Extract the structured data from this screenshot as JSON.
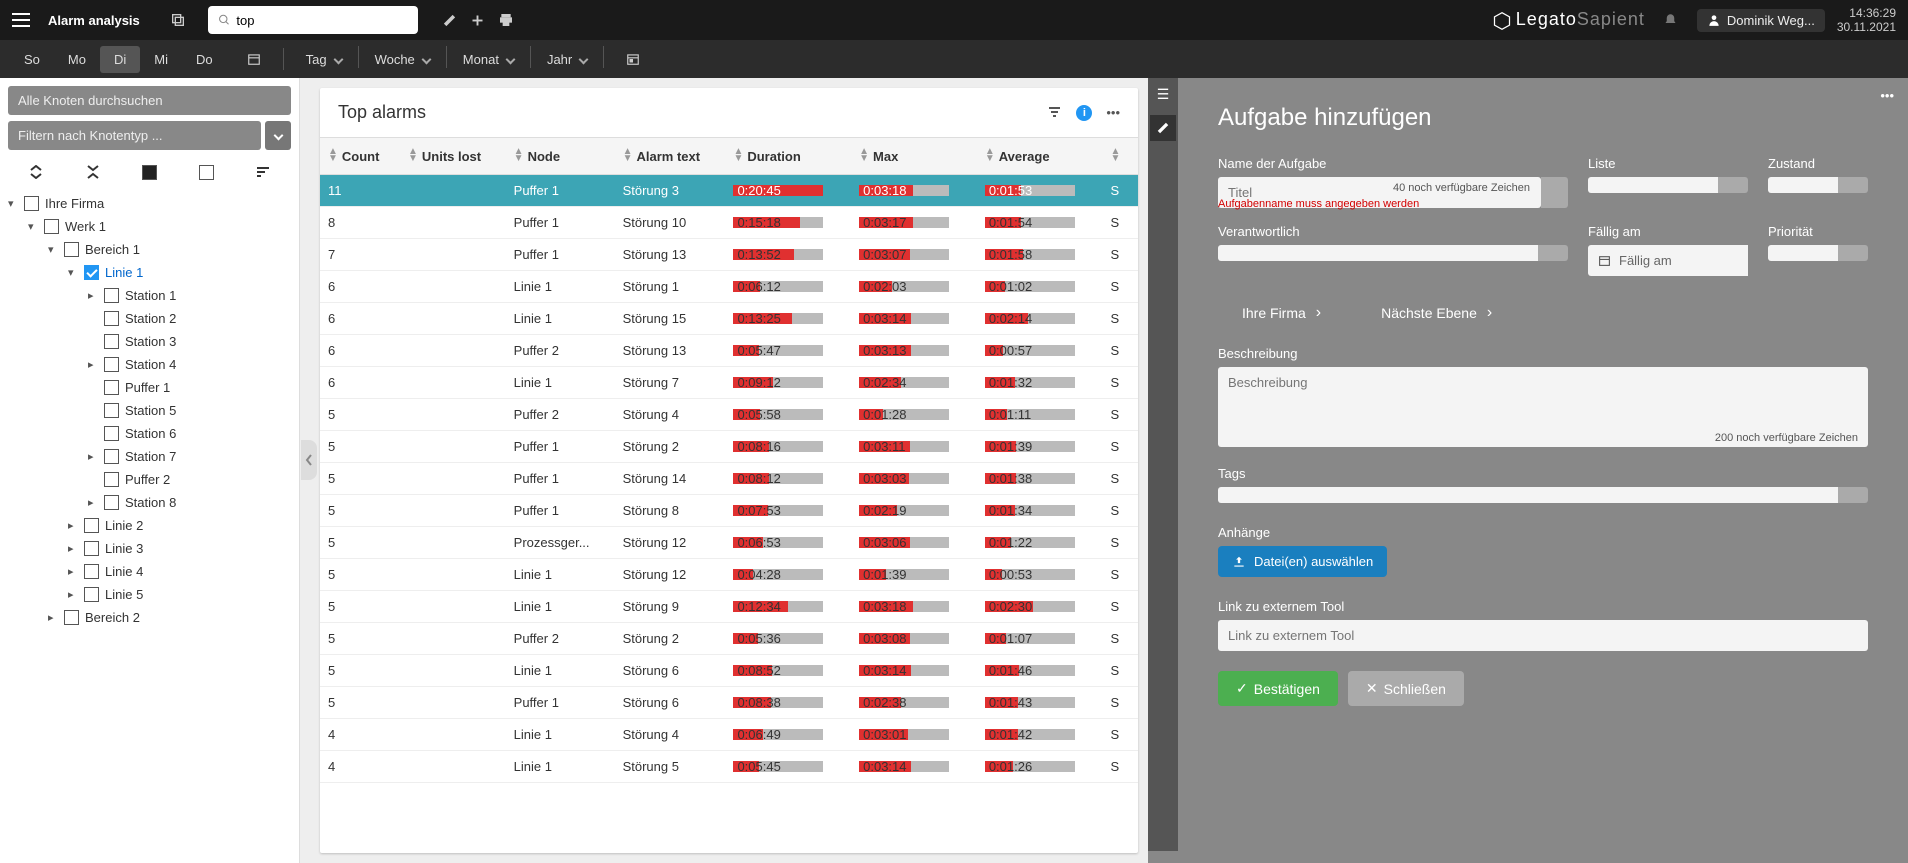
{
  "header": {
    "title": "Alarm analysis",
    "search_value": "top",
    "logo_main": "Legato",
    "logo_sub": "Sapient",
    "user": "Dominik Weg...",
    "time": "14:36:29",
    "date": "30.11.2021"
  },
  "toolbar": {
    "days": [
      "So",
      "Mo",
      "Di",
      "Mi",
      "Do"
    ],
    "day_active": "Di",
    "periods": [
      "Tag",
      "Woche",
      "Monat",
      "Jahr"
    ]
  },
  "sidebar": {
    "search_placeholder": "Alle Knoten durchsuchen",
    "filter_placeholder": "Filtern nach Knotentyp ...",
    "tree": [
      {
        "label": "Ihre Firma",
        "open": true,
        "children": [
          {
            "label": "Werk 1",
            "open": true,
            "children": [
              {
                "label": "Bereich 1",
                "open": true,
                "children": [
                  {
                    "label": "Linie 1",
                    "link": true,
                    "checked": true,
                    "open": true,
                    "children": [
                      {
                        "label": "Station 1",
                        "caret": true
                      },
                      {
                        "label": "Station 2"
                      },
                      {
                        "label": "Station 3"
                      },
                      {
                        "label": "Station 4",
                        "caret": true
                      },
                      {
                        "label": "Puffer 1"
                      },
                      {
                        "label": "Station 5"
                      },
                      {
                        "label": "Station 6"
                      },
                      {
                        "label": "Station 7",
                        "caret": true
                      },
                      {
                        "label": "Puffer 2"
                      },
                      {
                        "label": "Station 8",
                        "caret": true
                      }
                    ]
                  },
                  {
                    "label": "Linie 2",
                    "caret": true
                  },
                  {
                    "label": "Linie 3",
                    "caret": true
                  },
                  {
                    "label": "Linie 4",
                    "caret": true
                  },
                  {
                    "label": "Linie 5",
                    "caret": true
                  }
                ]
              },
              {
                "label": "Bereich 2",
                "caret": true
              }
            ]
          }
        ]
      }
    ]
  },
  "panel": {
    "title": "Top alarms",
    "columns": [
      "Count",
      "Units lost",
      "Node",
      "Alarm text",
      "Duration",
      "Max",
      "Average",
      ""
    ],
    "rows": [
      {
        "count": "11",
        "units": "",
        "node": "Puffer 1",
        "alarm": "Störung 3",
        "dur": "0:20:45",
        "dur_p": 100,
        "max": "0:03:18",
        "max_p": 60,
        "avg": "0:01:53",
        "avg_p": 40,
        "last": "S",
        "sel": true
      },
      {
        "count": "8",
        "units": "",
        "node": "Puffer 1",
        "alarm": "Störung 10",
        "dur": "0:15:18",
        "dur_p": 74,
        "max": "0:03:17",
        "max_p": 60,
        "avg": "0:01:54",
        "avg_p": 40
      },
      {
        "count": "7",
        "units": "",
        "node": "Puffer 1",
        "alarm": "Störung 13",
        "dur": "0:13:52",
        "dur_p": 67,
        "max": "0:03:07",
        "max_p": 56,
        "avg": "0:01:58",
        "avg_p": 42
      },
      {
        "count": "6",
        "units": "",
        "node": "Linie 1",
        "alarm": "Störung 1",
        "dur": "0:06:12",
        "dur_p": 30,
        "max": "0:02:03",
        "max_p": 37,
        "avg": "0:01:02",
        "avg_p": 22
      },
      {
        "count": "6",
        "units": "",
        "node": "Linie 1",
        "alarm": "Störung 15",
        "dur": "0:13:25",
        "dur_p": 65,
        "max": "0:03:14",
        "max_p": 58,
        "avg": "0:02:14",
        "avg_p": 48
      },
      {
        "count": "6",
        "units": "",
        "node": "Puffer 2",
        "alarm": "Störung 13",
        "dur": "0:05:47",
        "dur_p": 28,
        "max": "0:03:13",
        "max_p": 58,
        "avg": "0:00:57",
        "avg_p": 20
      },
      {
        "count": "6",
        "units": "",
        "node": "Linie 1",
        "alarm": "Störung 7",
        "dur": "0:09:12",
        "dur_p": 44,
        "max": "0:02:34",
        "max_p": 46,
        "avg": "0:01:32",
        "avg_p": 33
      },
      {
        "count": "5",
        "units": "",
        "node": "Puffer 2",
        "alarm": "Störung 4",
        "dur": "0:05:58",
        "dur_p": 29,
        "max": "0:01:28",
        "max_p": 27,
        "avg": "0:01:11",
        "avg_p": 25
      },
      {
        "count": "5",
        "units": "",
        "node": "Puffer 1",
        "alarm": "Störung 2",
        "dur": "0:08:16",
        "dur_p": 40,
        "max": "0:03:11",
        "max_p": 57,
        "avg": "0:01:39",
        "avg_p": 35
      },
      {
        "count": "5",
        "units": "",
        "node": "Puffer 1",
        "alarm": "Störung 14",
        "dur": "0:08:12",
        "dur_p": 40,
        "max": "0:03:03",
        "max_p": 55,
        "avg": "0:01:38",
        "avg_p": 35
      },
      {
        "count": "5",
        "units": "",
        "node": "Puffer 1",
        "alarm": "Störung 8",
        "dur": "0:07:53",
        "dur_p": 38,
        "max": "0:02:19",
        "max_p": 42,
        "avg": "0:01:34",
        "avg_p": 34
      },
      {
        "count": "5",
        "units": "",
        "node": "Prozessger...",
        "alarm": "Störung 12",
        "dur": "0:06:53",
        "dur_p": 33,
        "max": "0:03:06",
        "max_p": 56,
        "avg": "0:01:22",
        "avg_p": 29
      },
      {
        "count": "5",
        "units": "",
        "node": "Linie 1",
        "alarm": "Störung 12",
        "dur": "0:04:28",
        "dur_p": 22,
        "max": "0:01:39",
        "max_p": 30,
        "avg": "0:00:53",
        "avg_p": 19
      },
      {
        "count": "5",
        "units": "",
        "node": "Linie 1",
        "alarm": "Störung 9",
        "dur": "0:12:34",
        "dur_p": 61,
        "max": "0:03:18",
        "max_p": 60,
        "avg": "0:02:30",
        "avg_p": 54
      },
      {
        "count": "5",
        "units": "",
        "node": "Puffer 2",
        "alarm": "Störung 2",
        "dur": "0:05:36",
        "dur_p": 27,
        "max": "0:03:08",
        "max_p": 56,
        "avg": "0:01:07",
        "avg_p": 24
      },
      {
        "count": "5",
        "units": "",
        "node": "Linie 1",
        "alarm": "Störung 6",
        "dur": "0:08:52",
        "dur_p": 43,
        "max": "0:03:14",
        "max_p": 58,
        "avg": "0:01:46",
        "avg_p": 38
      },
      {
        "count": "5",
        "units": "",
        "node": "Puffer 1",
        "alarm": "Störung 6",
        "dur": "0:08:38",
        "dur_p": 42,
        "max": "0:02:38",
        "max_p": 47,
        "avg": "0:01:43",
        "avg_p": 37
      },
      {
        "count": "4",
        "units": "",
        "node": "Linie 1",
        "alarm": "Störung 4",
        "dur": "0:06:49",
        "dur_p": 33,
        "max": "0:03:01",
        "max_p": 54,
        "avg": "0:01:42",
        "avg_p": 37
      },
      {
        "count": "4",
        "units": "",
        "node": "Linie 1",
        "alarm": "Störung 5",
        "dur": "0:05:45",
        "dur_p": 28,
        "max": "0:03:14",
        "max_p": 58,
        "avg": "0:01:26",
        "avg_p": 31
      }
    ]
  },
  "rightpanel": {
    "title": "Aufgabe hinzufügen",
    "name_label": "Name der Aufgabe",
    "name_placeholder": "Titel",
    "name_hint": "40 noch verfügbare Zeichen",
    "list_label": "Liste",
    "state_label": "Zustand",
    "error": "Aufgabenname muss angegeben werden",
    "resp_label": "Verantwortlich",
    "due_label": "Fällig am",
    "due_placeholder": "Fällig am",
    "prio_label": "Priorität",
    "bc1": "Ihre Firma",
    "bc2": "Nächste Ebene",
    "desc_label": "Beschreibung",
    "desc_placeholder": "Beschreibung",
    "desc_hint": "200 noch verfügbare Zeichen",
    "tags_label": "Tags",
    "attach_label": "Anhänge",
    "upload_btn": "Datei(en) auswählen",
    "link_label": "Link zu externem Tool",
    "link_placeholder": "Link zu externem Tool",
    "confirm": "Bestätigen",
    "close": "Schließen"
  }
}
